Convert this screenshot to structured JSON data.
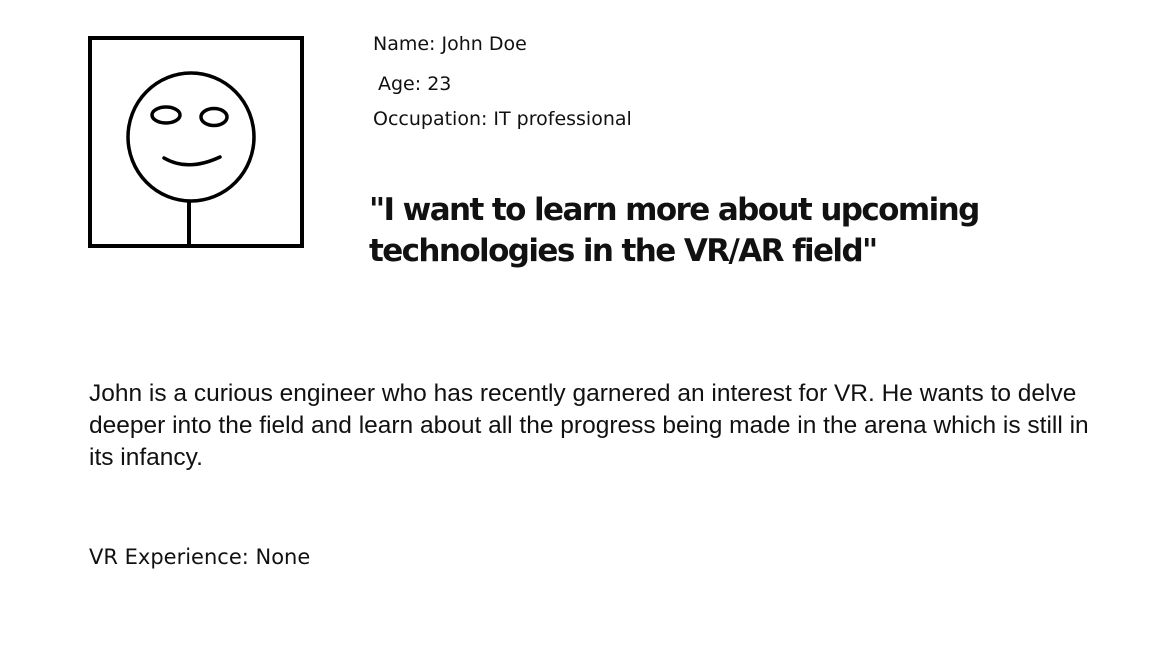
{
  "persona": {
    "name_line": "Name: John Doe",
    "age_line": "Age: 23",
    "occupation_line": "Occupation: IT professional",
    "quote": "\"I want to learn more about upcoming technologies in the VR/AR field\"",
    "bio": "John is a curious engineer who has recently garnered an interest for VR. He wants to delve deeper into the field and learn about all the progress being made in the arena which is still in its infancy.",
    "vr_experience_line": "VR Experience: None"
  },
  "avatar": {
    "icon": "stick-figure-smiley-icon",
    "stroke_color": "#000000"
  }
}
